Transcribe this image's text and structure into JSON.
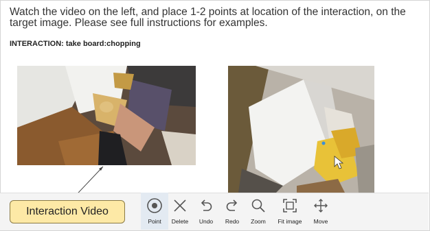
{
  "instructions": "Watch the video on the left, and place 1-2 points at location of the interaction, on the target image. Please see full instructions for examples.",
  "interaction_label": "INTERACTION: take board:chopping",
  "callout_label": "Interaction Video",
  "toolbar": {
    "tools": [
      {
        "name": "point",
        "label": "Point",
        "icon": "target-icon",
        "active": true
      },
      {
        "name": "delete",
        "label": "Delete",
        "icon": "close-icon"
      },
      {
        "name": "undo",
        "label": "Undo",
        "icon": "undo-icon"
      },
      {
        "name": "redo",
        "label": "Redo",
        "icon": "redo-icon"
      },
      {
        "name": "zoom",
        "label": "Zoom",
        "icon": "magnifier-icon"
      },
      {
        "name": "fit-image",
        "label": "Fit image",
        "icon": "fit-screen-icon"
      },
      {
        "name": "move",
        "label": "Move",
        "icon": "move-arrows-icon"
      }
    ]
  },
  "colors": {
    "callout_bg": "#fde9a6",
    "active_tool_bg": "#e3eaf2",
    "point_marker": "#3b8fd8"
  }
}
